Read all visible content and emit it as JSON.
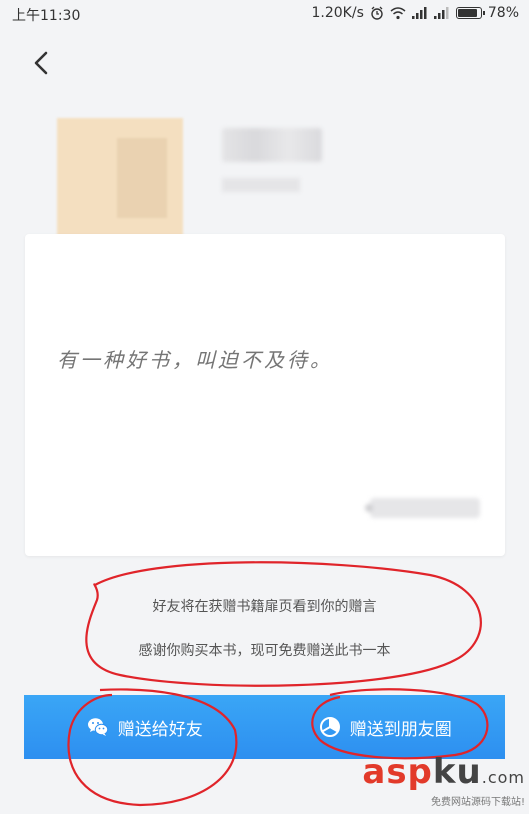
{
  "status_bar": {
    "time": "上午11:30",
    "network_speed": "1.20K/s",
    "battery": "78%",
    "battery_level": 78
  },
  "header": {
    "back_icon": "chevron-left-icon"
  },
  "card": {
    "message": "有一种好书，叫迫不及待。"
  },
  "hints": {
    "line1": "好友将在获赠书籍扉页看到你的赠言",
    "line2": "感谢你购买本书，现可免费赠送此书一本"
  },
  "actions": [
    {
      "label": "赠送给好友",
      "icon": "wechat-icon"
    },
    {
      "label": "赠送到朋友圈",
      "icon": "moments-icon"
    }
  ],
  "watermark": {
    "brand_asp": "asp",
    "brand_ku": "ku",
    "brand_com": ".com",
    "tagline": "免费网站源码下载站!"
  },
  "colors": {
    "action_bar": "#2d8ff0",
    "annotation": "#e0242a",
    "background": "#f3f4f6"
  }
}
